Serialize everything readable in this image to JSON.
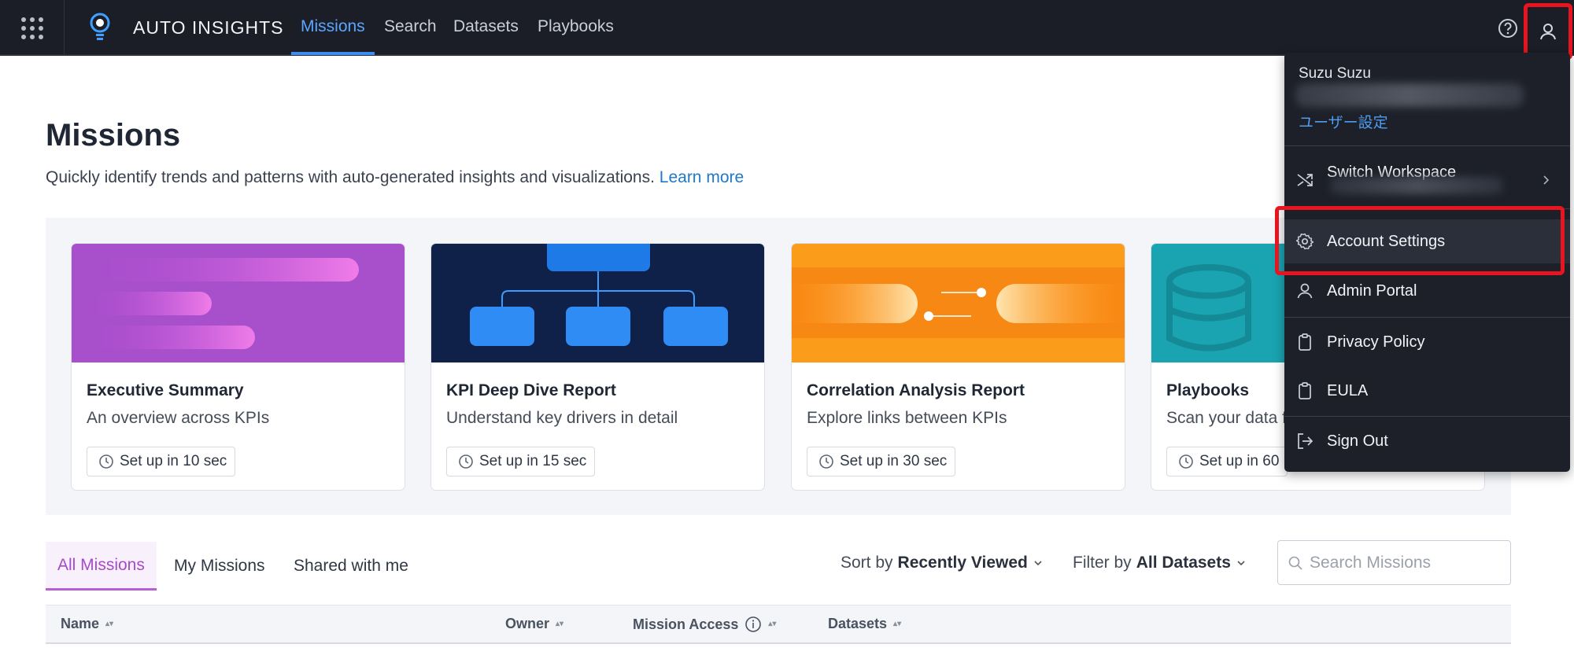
{
  "topbar": {
    "app_title": "AUTO INSIGHTS",
    "nav": [
      "Missions",
      "Search",
      "Datasets",
      "Playbooks"
    ],
    "active_nav": "Missions"
  },
  "page": {
    "title": "Missions",
    "subtitle": "Quickly identify trends and patterns with auto-generated insights and visualizations.",
    "learn_more": "Learn more"
  },
  "cards": [
    {
      "title": "Executive Summary",
      "desc": "An overview across KPIs",
      "setup": "Set up in 10 sec"
    },
    {
      "title": "KPI Deep Dive Report",
      "desc": "Understand key drivers in detail",
      "setup": "Set up in 15 sec"
    },
    {
      "title": "Correlation Analysis Report",
      "desc": "Explore links between KPIs",
      "setup": "Set up in 30 sec"
    },
    {
      "title": "Playbooks",
      "desc": "Scan your data f",
      "setup": "Set up in 60"
    }
  ],
  "tabs": [
    "All Missions",
    "My Missions",
    "Shared with me"
  ],
  "sort": {
    "prefix": "Sort by",
    "value": "Recently Viewed"
  },
  "filter": {
    "prefix": "Filter by",
    "value": "All Datasets"
  },
  "search": {
    "placeholder": "Search Missions"
  },
  "table": {
    "headers": [
      "Name",
      "Owner",
      "Mission Access",
      "Datasets"
    ]
  },
  "user_menu": {
    "name": "Suzu Suzu",
    "user_settings_link": "ユーザー設定",
    "items": {
      "switch_workspace": "Switch Workspace",
      "account_settings": "Account Settings",
      "admin_portal": "Admin Portal",
      "privacy_policy": "Privacy Policy",
      "eula": "EULA",
      "sign_out": "Sign Out"
    }
  },
  "colors": {
    "topbar_bg": "#1b1e26",
    "accent_blue": "#5aa6ff",
    "tab_purple": "#a74ac8",
    "highlight_red": "#e8141f"
  }
}
